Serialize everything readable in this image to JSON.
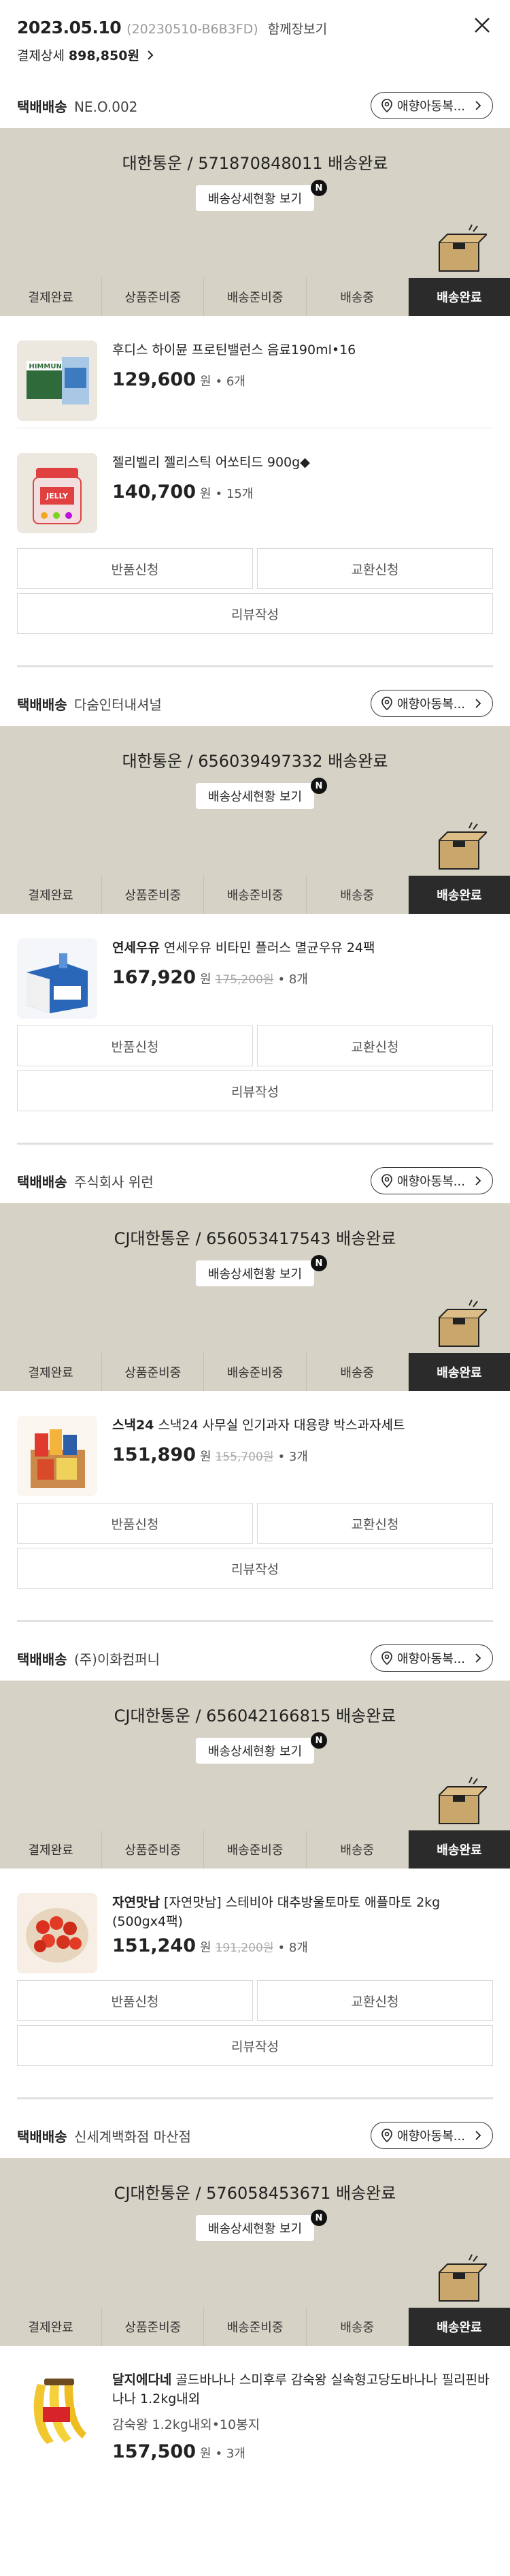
{
  "header": {
    "date": "2023.05.10",
    "order_no": "(20230510-B6B3FD)",
    "cart_view": "함께장보기",
    "payment_label": "결제상세",
    "payment_amount": "898,850원"
  },
  "steps": [
    "결제완료",
    "상품준비중",
    "배송준비중",
    "배송중",
    "배송완료"
  ],
  "dest_label": "애향아동복...",
  "detail_btn": "배송상세현황 보기",
  "n_badge": "N",
  "buttons": {
    "return": "반품신청",
    "exchange": "교환신청",
    "review": "리뷰작성"
  },
  "shipments": [
    {
      "type": "택배배송",
      "seller": "NE.O.002",
      "carrier": "대한통운 / 571870848011 배송완료",
      "items": [
        {
          "name": "후디스 하이뮨 프로틴밸런스 음료190ml•16",
          "price": "129,600",
          "unit": "원",
          "qty": "• 6개"
        },
        {
          "name": "젤리벨리 젤리스틱 어쏘티드 900g◆",
          "price": "140,700",
          "unit": "원",
          "qty": "• 15개"
        }
      ]
    },
    {
      "type": "택배배송",
      "seller": "다숨인터내셔널",
      "carrier": "대한통운 / 656039497332 배송완료",
      "items": [
        {
          "brand": "연세우유",
          "name": "연세우유 비타민 플러스 멸균우유 24팩",
          "price": "167,920",
          "unit": "원",
          "orig": "175,200원",
          "qty": "• 8개"
        }
      ]
    },
    {
      "type": "택배배송",
      "seller": "주식회사 위런",
      "carrier": "CJ대한통운 / 656053417543 배송완료",
      "items": [
        {
          "brand": "스낵24",
          "name": "스낵24 사무실 인기과자 대용량 박스과자세트",
          "price": "151,890",
          "unit": "원",
          "orig": "155,700원",
          "qty": "• 3개"
        }
      ]
    },
    {
      "type": "택배배송",
      "seller": "(주)이화컴퍼니",
      "carrier": "CJ대한통운 / 656042166815 배송완료",
      "items": [
        {
          "brand": "자연맛남",
          "name": "[자연맛남] 스테비아 대추방울토마토 애플마토 2kg (500gx4팩)",
          "price": "151,240",
          "unit": "원",
          "orig": "191,200원",
          "qty": "• 8개"
        }
      ]
    },
    {
      "type": "택배배송",
      "seller": "신세계백화점 마산점",
      "carrier": "CJ대한통운 / 576058453671 배송완료",
      "items": [
        {
          "brand": "달지에다네",
          "name": "골드바나나 스미후루 감숙왕 실속형고당도바나나 필리핀바나나 1.2kg내외",
          "option": "감숙왕 1.2kg내외•10봉지",
          "price": "157,500",
          "unit": "원",
          "qty": "• 3개"
        }
      ]
    }
  ]
}
